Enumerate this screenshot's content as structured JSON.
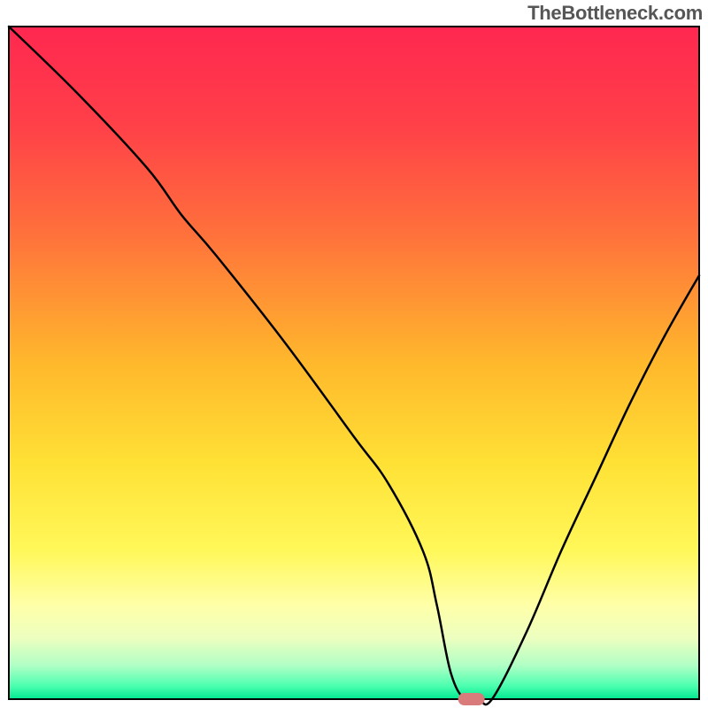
{
  "watermark": "TheBottleneck.com",
  "chart_data": {
    "type": "line",
    "title": "",
    "xlabel": "",
    "ylabel": "",
    "xlim": [
      0,
      100
    ],
    "ylim": [
      0,
      100
    ],
    "x": [
      0,
      10,
      20,
      25,
      30,
      40,
      50,
      55,
      60,
      62,
      64,
      66,
      68,
      70,
      75,
      80,
      85,
      90,
      95,
      100
    ],
    "y": [
      100,
      90,
      79,
      72,
      66,
      53,
      39,
      32,
      22,
      14,
      4,
      0,
      0,
      0,
      10,
      22,
      33,
      44,
      54,
      63
    ],
    "marker": {
      "x": 67,
      "y": 0,
      "color": "#d87b7a"
    },
    "gradient_stops": [
      {
        "offset": 0.0,
        "color": "#ff2750"
      },
      {
        "offset": 0.15,
        "color": "#ff4148"
      },
      {
        "offset": 0.3,
        "color": "#ff6e3c"
      },
      {
        "offset": 0.5,
        "color": "#ffb82c"
      },
      {
        "offset": 0.65,
        "color": "#ffe135"
      },
      {
        "offset": 0.78,
        "color": "#fff85a"
      },
      {
        "offset": 0.86,
        "color": "#ffffa8"
      },
      {
        "offset": 0.91,
        "color": "#ecffc0"
      },
      {
        "offset": 0.95,
        "color": "#b0ffc5"
      },
      {
        "offset": 0.98,
        "color": "#4dffb0"
      },
      {
        "offset": 1.0,
        "color": "#00e890"
      }
    ],
    "grid": false,
    "legend_position": "none"
  }
}
